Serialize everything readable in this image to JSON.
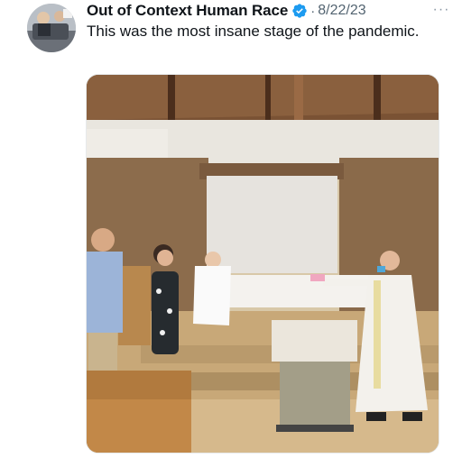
{
  "tweet": {
    "author_name": "Out of Context Human Race",
    "separator": "·",
    "date": "8/22/23",
    "text": "This was the most insane stage of the pandemic.",
    "more_label": "···"
  },
  "icons": {
    "verified": "verified-badge-icon",
    "more": "more-options-icon"
  },
  "colors": {
    "verified_blue": "#1d9bf0",
    "secondary_text": "#536471"
  }
}
